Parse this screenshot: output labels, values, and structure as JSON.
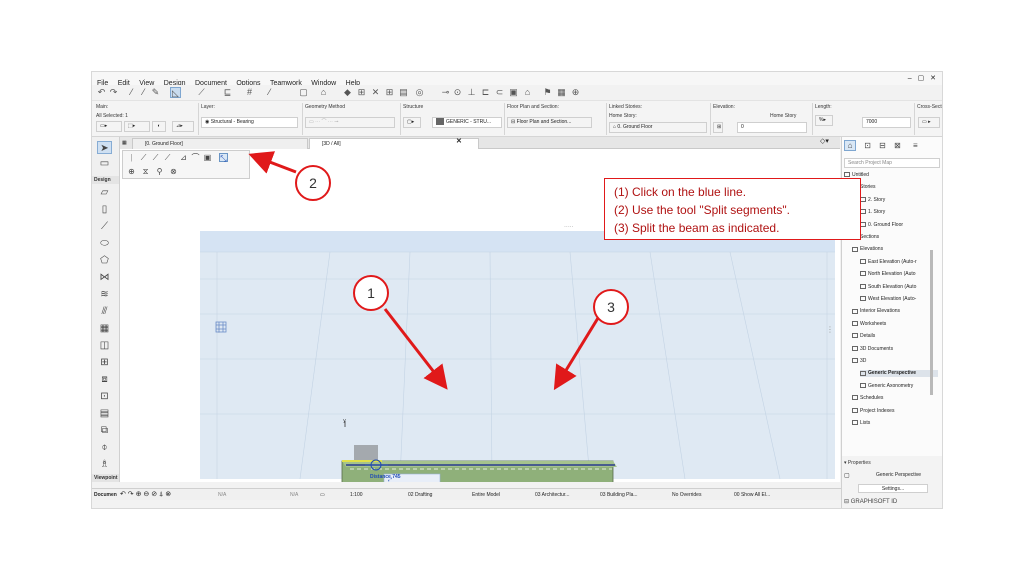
{
  "menu": [
    "File",
    "Edit",
    "View",
    "Design",
    "Document",
    "Options",
    "Teamwork",
    "Window",
    "Help"
  ],
  "window_controls": "– ▢ ✕",
  "info_box": {
    "main_label": "Main:",
    "all_selected": "All Selected: 1",
    "layer_label": "Layer:",
    "layer_value": "Structural - Bearing",
    "geometry_label": "Geometry Method",
    "structure_label": "Structure",
    "structure_value": "GENERIC - STRU...",
    "floor_plan_label": "Floor Plan and Section:",
    "floor_plan_value": "Floor Plan and Section...",
    "linked_stories_label": "Linked Stories:",
    "home_story_label": "Home Story:",
    "home_story_value": "0. Ground Floor",
    "elevation_label": "Elevation:",
    "elevation_home": "Home Story",
    "elevation_value": "0",
    "length_label": "Length:",
    "length_value": "7000",
    "cross_section_label": "Cross-Secti"
  },
  "tabs": [
    {
      "label": "[0. Ground Floor]"
    },
    {
      "label": "[3D / All]"
    }
  ],
  "left_toolbox": {
    "design_label": "Design",
    "viewpoint_label": "Viewpoint",
    "document_label": "Documen"
  },
  "canvas": {
    "axis_y": "y",
    "distance_tooltip": "Distance 745"
  },
  "callout": {
    "line1": "(1) Click on the blue line.",
    "line2": "(2) Use the tool \"Split segments\".",
    "line3": "(3) Split the beam as indicated."
  },
  "markers": [
    "1",
    "2",
    "3"
  ],
  "navigator": {
    "search_placeholder": "Search Project Map",
    "items": [
      {
        "label": "Untitled",
        "level": 0
      },
      {
        "label": "Stories",
        "level": 1
      },
      {
        "label": "2. Story",
        "level": 2
      },
      {
        "label": "1. Story",
        "level": 2
      },
      {
        "label": "0. Ground Floor",
        "level": 2
      },
      {
        "label": "Sections",
        "level": 1
      },
      {
        "label": "Elevations",
        "level": 1
      },
      {
        "label": "East Elevation (Auto-r",
        "level": 2
      },
      {
        "label": "North Elevation (Auto",
        "level": 2
      },
      {
        "label": "South Elevation (Auto",
        "level": 2
      },
      {
        "label": "West Elevation (Auto-",
        "level": 2
      },
      {
        "label": "Interior Elevations",
        "level": 1
      },
      {
        "label": "Worksheets",
        "level": 1
      },
      {
        "label": "Details",
        "level": 1
      },
      {
        "label": "3D Documents",
        "level": 1
      },
      {
        "label": "3D",
        "level": 1
      },
      {
        "label": "Generic Perspective",
        "level": 2,
        "selected": true
      },
      {
        "label": "Generic Axonometry",
        "level": 2
      },
      {
        "label": "Schedules",
        "level": 1
      },
      {
        "label": "Project Indexes",
        "level": 1
      },
      {
        "label": "Lists",
        "level": 1
      }
    ],
    "properties_label": "Properties",
    "properties_value": "Generic Perspective",
    "settings_button": "Settings...",
    "brand": "GRAPHISOFT ID"
  },
  "statusbar": {
    "na1": "N/A",
    "na2": "N/A",
    "scale": "1:100",
    "pen_set": "02 Drafting",
    "model": "Entire Model",
    "view": "03 Architectur...",
    "building": "03 Building Pla...",
    "overrides": "No Overrides",
    "show": "00 Show All El..."
  },
  "colors": {
    "annotation_red": "#e0191a",
    "beam_green": "#8fb07a",
    "sky_blue": "#d5e3f3",
    "ground": "#e6edf2"
  }
}
